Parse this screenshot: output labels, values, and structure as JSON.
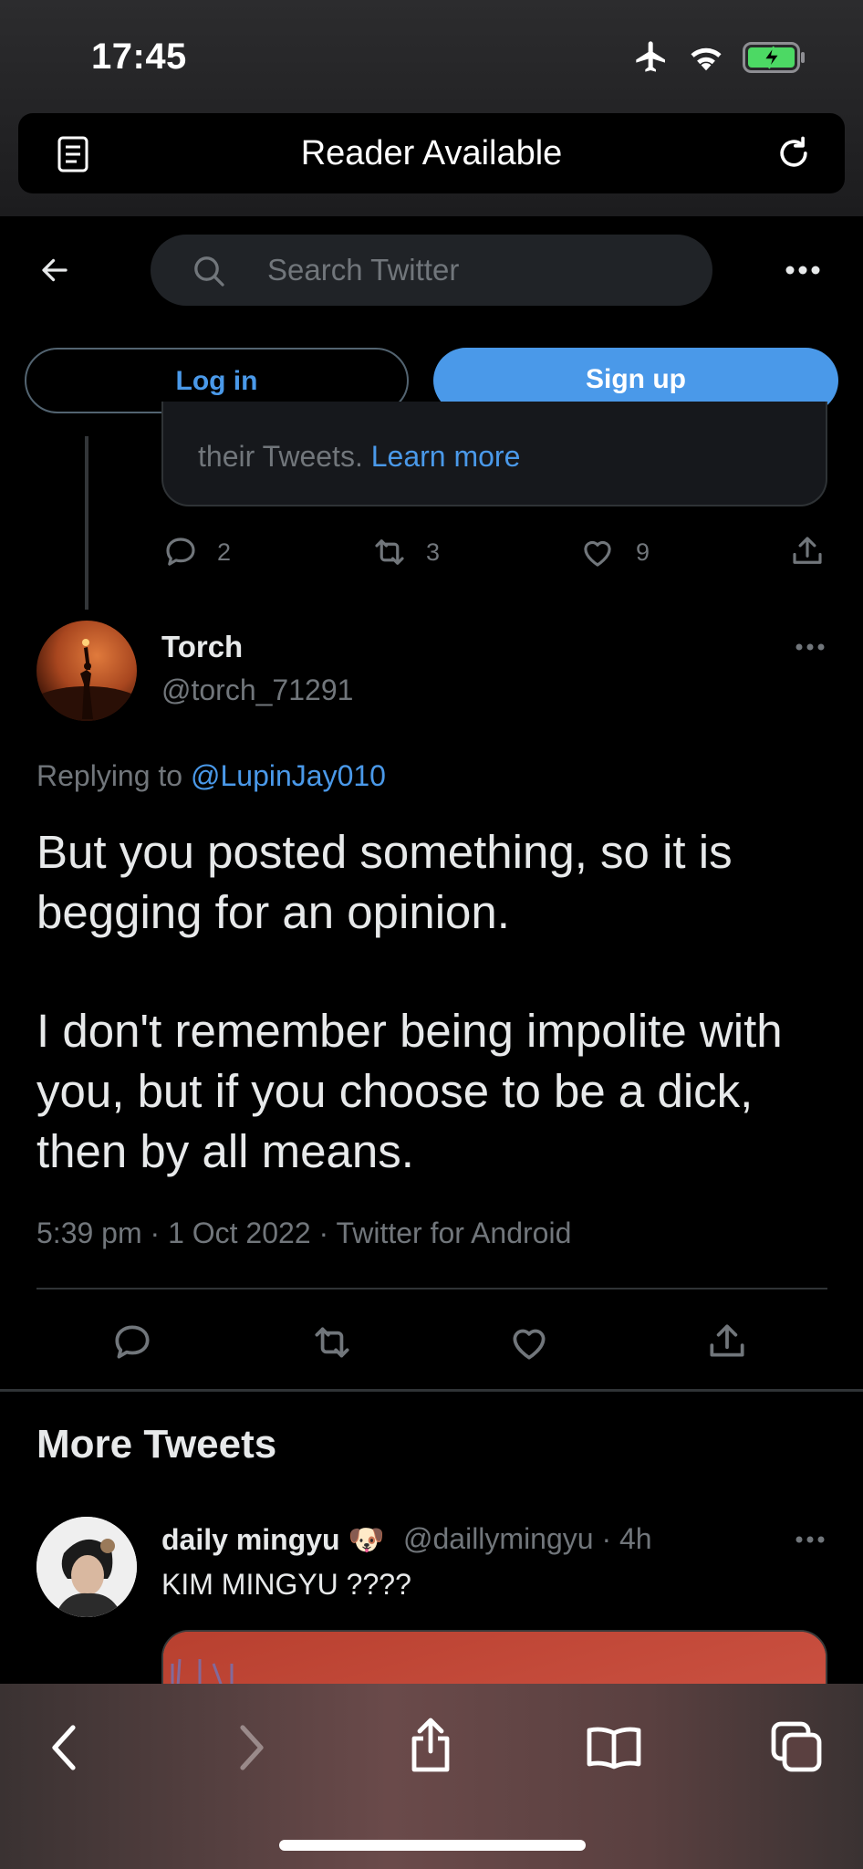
{
  "status_bar": {
    "time": "17:45"
  },
  "browser": {
    "reader_label": "Reader Available"
  },
  "twitter_header": {
    "search_placeholder": "Search Twitter"
  },
  "auth": {
    "login_label": "Log in",
    "signup_label": "Sign up"
  },
  "previous_tweet": {
    "notice_text": "their Tweets.",
    "notice_link": "Learn more",
    "replies": "2",
    "retweets": "3",
    "likes": "9"
  },
  "tweet": {
    "name": "Torch",
    "handle": "@torch_71291",
    "replying_prefix": "Replying to",
    "replying_to": "@LupinJay010",
    "body_lines": [
      "But you posted something, so it is",
      "begging for an opinion.",
      "I don't remember being impolite with",
      "you, but if you choose to be a dick,",
      "then by all means."
    ],
    "meta": "5:39 pm · 1 Oct 2022 · Twitter for Android"
  },
  "more_tweets": {
    "title": "More Tweets",
    "items": [
      {
        "name": "daily mingyu",
        "emoji": "🐶",
        "handle": "@daillymingyu · 4h",
        "text": "KIM MINGYU ????"
      }
    ]
  },
  "colors": {
    "accent": "#4a99e9",
    "muted": "#71767b",
    "background": "#000000"
  }
}
